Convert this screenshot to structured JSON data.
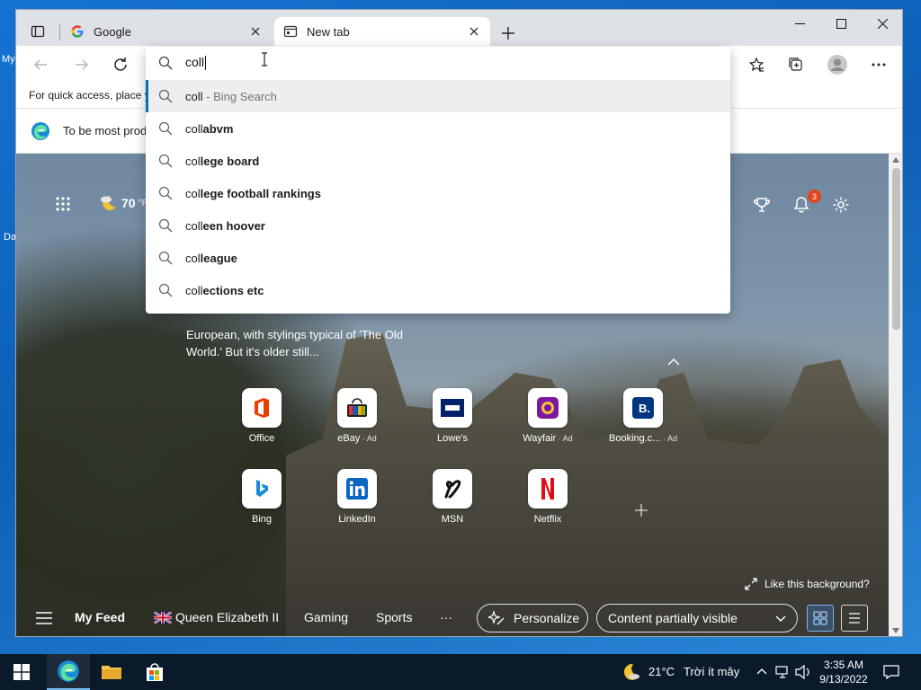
{
  "desktop": {
    "label_top": "My",
    "label_bottom": "Da"
  },
  "tabs": [
    {
      "title": "Google",
      "icon": "google-icon"
    },
    {
      "title": "New tab",
      "icon": "newtab-icon"
    }
  ],
  "address": {
    "typed": "coll"
  },
  "favorites_bar": {
    "text": "For quick access, place y"
  },
  "infobar": {
    "text": "To be most prod"
  },
  "suggestions": [
    {
      "typed": "coll",
      "rest": "",
      "engine": " - Bing Search",
      "selected": true
    },
    {
      "typed": "coll",
      "rest": "abvm",
      "engine": ""
    },
    {
      "typed": "col",
      "rest": "lege board",
      "engine": ""
    },
    {
      "typed": "col",
      "rest": "lege football rankings",
      "engine": ""
    },
    {
      "typed": "coll",
      "rest": "een hoover",
      "engine": ""
    },
    {
      "typed": "col",
      "rest": "league",
      "engine": ""
    },
    {
      "typed": "coll",
      "rest": "ections etc",
      "engine": ""
    }
  ],
  "ntp": {
    "weather_temp": "70",
    "weather_unit": "°F",
    "notification_count": "3",
    "story_text": "European, with stylings typical of 'The Old World.' But it's older still...",
    "like_background": "Like this background?",
    "tiles_row1": [
      {
        "label": "Office",
        "ad": ""
      },
      {
        "label": "eBay",
        "ad": " · Ad"
      },
      {
        "label": "Lowe's",
        "ad": ""
      },
      {
        "label": "Wayfair",
        "ad": " · Ad"
      },
      {
        "label": "Booking.c...",
        "ad": " · Ad"
      }
    ],
    "tiles_row2": [
      {
        "label": "Bing",
        "ad": ""
      },
      {
        "label": "LinkedIn",
        "ad": ""
      },
      {
        "label": "MSN",
        "ad": ""
      },
      {
        "label": "Netflix",
        "ad": ""
      }
    ],
    "feed": {
      "my_feed": "My Feed",
      "queen": "Queen Elizabeth II",
      "gaming": "Gaming",
      "sports": "Sports",
      "more": "···",
      "personalize": "Personalize",
      "content_mode": "Content partially visible"
    }
  },
  "taskbar": {
    "weather": "21°C",
    "weather_desc": "Trời ít mây",
    "time": "3:35 AM",
    "date": "9/13/2022"
  }
}
